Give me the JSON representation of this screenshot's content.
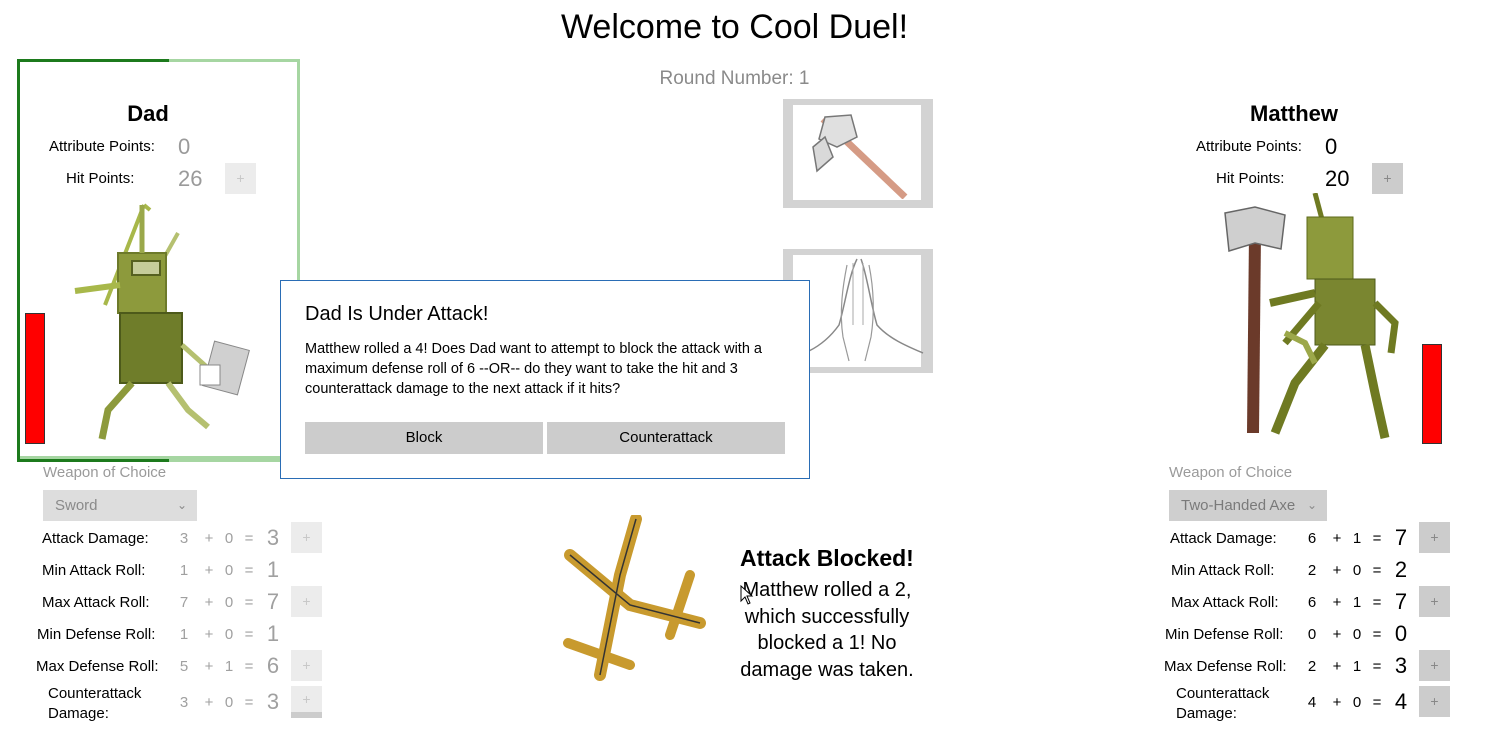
{
  "header": {
    "title": "Welcome to Cool Duel!",
    "round": "Round Number: 1"
  },
  "left_player": {
    "name": "Dad",
    "attr_label": "Attribute Points:",
    "attr_value": "0",
    "hp_label": "Hit Points:",
    "hp_value": "26",
    "plus": "+",
    "hp_level": 1.0,
    "weapon_label": "Weapon of Choice",
    "weapon_value": "Sword",
    "stats": [
      {
        "label": "Attack Damage:",
        "base": "3",
        "bonus": "0",
        "total": "3"
      },
      {
        "label": "Min Attack Roll:",
        "base": "1",
        "bonus": "0",
        "total": "1"
      },
      {
        "label": "Max Attack Roll:",
        "base": "7",
        "bonus": "0",
        "total": "7"
      },
      {
        "label": "Min Defense Roll:",
        "base": "1",
        "bonus": "0",
        "total": "1"
      },
      {
        "label": "Max Defense Roll:",
        "base": "5",
        "bonus": "1",
        "total": "6"
      },
      {
        "label": "Counterattack Damage:",
        "base": "3",
        "bonus": "0",
        "total": "3"
      }
    ]
  },
  "right_player": {
    "name": "Matthew",
    "attr_label": "Attribute Points:",
    "attr_value": "0",
    "hp_label": "Hit Points:",
    "hp_value": "20",
    "plus": "+",
    "hp_level": 1.0,
    "weapon_label": "Weapon of Choice",
    "weapon_value": "Two-Handed Axe",
    "stats": [
      {
        "label": "Attack Damage:",
        "base": "6",
        "bonus": "1",
        "total": "7"
      },
      {
        "label": "Min Attack Roll:",
        "base": "2",
        "bonus": "0",
        "total": "2"
      },
      {
        "label": "Max Attack Roll:",
        "base": "6",
        "bonus": "1",
        "total": "7"
      },
      {
        "label": "Min Defense Roll:",
        "base": "0",
        "bonus": "0",
        "total": "0"
      },
      {
        "label": "Max Defense Roll:",
        "base": "2",
        "bonus": "1",
        "total": "3"
      },
      {
        "label": "Counterattack Damage:",
        "base": "4",
        "bonus": "0",
        "total": "4"
      }
    ]
  },
  "ops": {
    "plus": "+",
    "equals": "="
  },
  "dialog": {
    "title": "Dad Is Under Attack!",
    "body": "Matthew rolled a 4! Does Dad want to attempt to block the attack with a maximum defense roll of 6  --OR-- do they want to take the hit and 3 counterattack damage to the next attack if it hits?",
    "block_label": "Block",
    "counter_label": "Counterattack"
  },
  "result": {
    "title": "Attack Blocked!",
    "text": "Matthew rolled a 2, which successfully blocked a 1! No damage was taken."
  },
  "icons": {
    "attack_icon": "axe-icon",
    "defend_icon": "praying-hands-icon",
    "result_icon": "crossed-swords-icon"
  },
  "colors": {
    "active_border": "#1c7a1c",
    "inactive_border": "#a6d6a2",
    "hp_bar": "#ff0000",
    "dialog_border": "#2a6db5"
  }
}
